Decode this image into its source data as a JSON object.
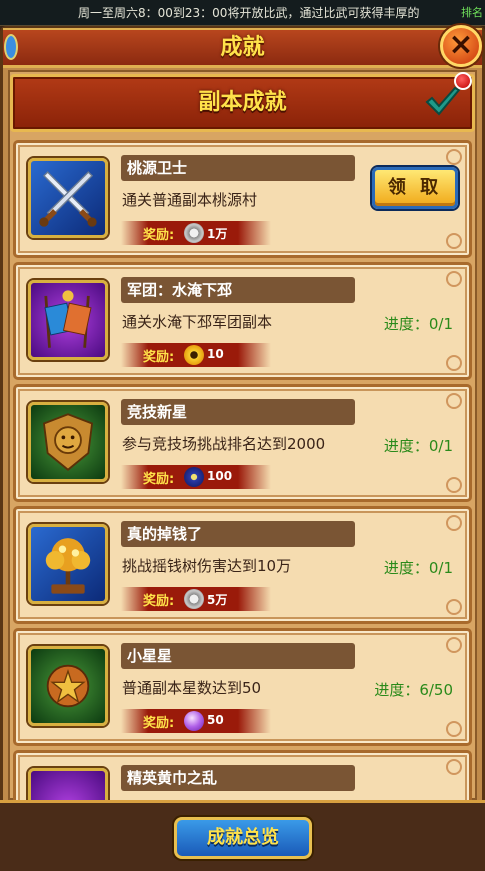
{
  "marquee": {
    "text": "周一至周六8：00到23：00将开放比武，通过比武可获得丰厚的",
    "tail": "排名"
  },
  "header": {
    "title": "成就",
    "close_label": "×"
  },
  "section": {
    "title": "副本成就"
  },
  "achievements": [
    {
      "name": "桃源卫士",
      "desc": "通关普通副本桃源村",
      "reward_label": "奖励:",
      "reward_amount": "1万",
      "reward_icon": "silver-coin-icon",
      "action": "领 取",
      "progress": ""
    },
    {
      "name": "军团：水淹下邳",
      "desc": "通关水淹下邳军团副本",
      "reward_label": "奖励:",
      "reward_amount": "10",
      "reward_icon": "gold-coin-icon",
      "progress": "进度：0/1"
    },
    {
      "name": "竞技新星",
      "desc": "参与竞技场挑战排名达到2000",
      "reward_label": "奖励:",
      "reward_amount": "100",
      "reward_icon": "arena-token-icon",
      "progress": "进度：0/1"
    },
    {
      "name": "真的掉钱了",
      "desc": "挑战摇钱树伤害达到10万",
      "reward_label": "奖励:",
      "reward_amount": "5万",
      "reward_icon": "silver-coin-icon",
      "progress": "进度：0/1"
    },
    {
      "name": "小星星",
      "desc": "普通副本星数达到50",
      "reward_label": "奖励:",
      "reward_amount": "50",
      "reward_icon": "purple-orb-icon",
      "progress": "进度：6/50"
    },
    {
      "name": "精英黄巾之乱",
      "desc": "",
      "reward_label": "",
      "reward_amount": "",
      "progress": ""
    }
  ],
  "footer": {
    "overview_label": "成就总览"
  },
  "colors": {
    "accent": "#ffe24a",
    "progress": "#2a8a1a",
    "panel": "#f5dcb0"
  }
}
